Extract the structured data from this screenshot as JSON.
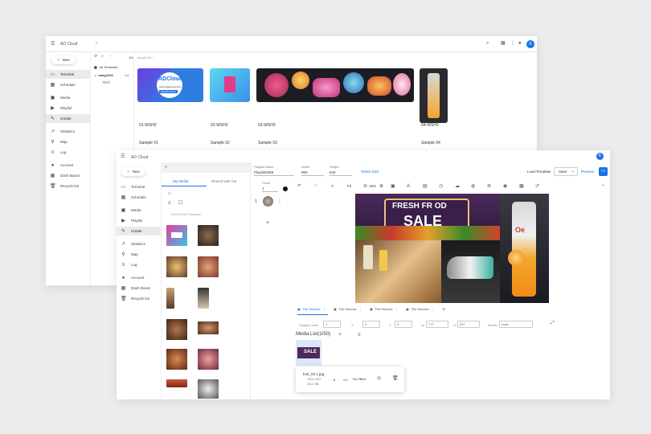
{
  "back_window": {
    "title": "AD Cloud",
    "new_label": "New",
    "nav": [
      {
        "label": "Terminal",
        "icon": "monitor-icon",
        "active": true
      },
      {
        "label": "Schedule",
        "icon": "calendar-icon"
      },
      {
        "label": "Media",
        "icon": "image-icon"
      },
      {
        "label": "Playlist",
        "icon": "playlist-icon"
      },
      {
        "label": "Create",
        "icon": "pencil-icon",
        "active": true
      },
      {
        "label": "Statistics",
        "icon": "chart-icon"
      },
      {
        "label": "Map",
        "icon": "pin-icon"
      },
      {
        "label": "Log",
        "icon": "list-icon"
      },
      {
        "label": "Account",
        "icon": "person-icon"
      },
      {
        "label": "Dash Board",
        "icon": "dashboard-icon"
      },
      {
        "label": "Recycle bin",
        "icon": "trash-icon"
      }
    ],
    "tree": {
      "count": "1/4",
      "all": "All Terminals",
      "group": "sang1234",
      "group_count": "1/4",
      "child": "TEST"
    },
    "breadcrumb": "sang1234",
    "cards": [
      {
        "name": "01-WSH2",
        "sample": "Sample 01"
      },
      {
        "name": "02-WSH2",
        "sample": "Sample 02"
      },
      {
        "name": "03-WSH3",
        "sample": "Sample 03"
      },
      {
        "name": "04-WSH3",
        "sample": "Sample 04"
      }
    ],
    "card1_brand": "ADCloud",
    "card1_url": "www.adsignnow.com",
    "card1_tag": "PROMOTION"
  },
  "front_window": {
    "title": "AD Cloud",
    "avatar": "K",
    "new_label": "New",
    "nav": [
      {
        "label": "Terminal"
      },
      {
        "label": "Schedule"
      },
      {
        "label": "Media"
      },
      {
        "label": "Playlist"
      },
      {
        "label": "Create",
        "active": true
      },
      {
        "label": "Statistics"
      },
      {
        "label": "Map"
      },
      {
        "label": "Log"
      },
      {
        "label": "Account"
      },
      {
        "label": "Dash Board"
      },
      {
        "label": "Recycle bin"
      }
    ],
    "media_tabs": {
      "mine": "My Media",
      "shared": "Shared with me"
    },
    "date": "2024-03-04 Tuesday",
    "playlist_name_label": "Playlist Name",
    "playlist_name": "Playlist4366",
    "width_label": "Width",
    "width": "960",
    "height_label": "Height",
    "height": "540",
    "select_size": "Select Size",
    "load_template": "Load Template",
    "save": "Save",
    "preview": "Preview",
    "order_label": "Order",
    "order": "1",
    "fit": "Fit",
    "zoom": "19%",
    "slot_number": "1",
    "canvas_text": {
      "headline": "FRESH FR OD",
      "sale": "SALE",
      "sub": "2.5.0",
      "brand": "Oe"
    },
    "windows": [
      "File Window",
      "File Window",
      "File Window",
      "File Window"
    ],
    "display_level_label": "Display Level",
    "display_level": "1",
    "x_label": "X",
    "x": "0",
    "y_label": "Y",
    "y": "0",
    "w_label": "W",
    "w": "777",
    "h_label": "H",
    "h": "227",
    "border_label": "Border",
    "border": "none",
    "media_list": "Media List(1/50)",
    "file": {
      "name": "fruit_02-1.jpg",
      "dims": "1024 x 557",
      "size": "241.1 KB",
      "duration": "8",
      "unit": "sec",
      "effect": "No Effect",
      "thumb_text": "SALE"
    }
  }
}
